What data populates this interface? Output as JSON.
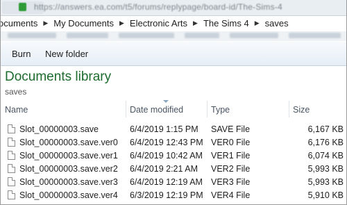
{
  "browser": {
    "url": "https://answers.ea.com/t5/forums/replypage/board-id/The-Sims-4"
  },
  "breadcrumb": [
    "ocuments",
    "My Documents",
    "Electronic Arts",
    "The Sims 4",
    "saves"
  ],
  "toolbar": {
    "burn_label": "Burn",
    "new_folder_label": "New folder"
  },
  "library": {
    "title": "Documents library",
    "subtitle": "saves"
  },
  "columns": {
    "name": "Name",
    "date": "Date modified",
    "type": "Type",
    "size": "Size"
  },
  "files": [
    {
      "name": "Slot_00000003.save",
      "date": "6/4/2019 1:15 PM",
      "type": "SAVE File",
      "size": "6,167 KB"
    },
    {
      "name": "Slot_00000003.save.ver0",
      "date": "6/4/2019 12:43 PM",
      "type": "VER0 File",
      "size": "6,176 KB"
    },
    {
      "name": "Slot_00000003.save.ver1",
      "date": "6/4/2019 10:42 AM",
      "type": "VER1 File",
      "size": "6,074 KB"
    },
    {
      "name": "Slot_00000003.save.ver2",
      "date": "6/4/2019 2:21 AM",
      "type": "VER2 File",
      "size": "5,993 KB"
    },
    {
      "name": "Slot_00000003.save.ver3",
      "date": "6/4/2019 12:19 AM",
      "type": "VER3 File",
      "size": "5,993 KB"
    },
    {
      "name": "Slot_00000003.save.ver4",
      "date": "6/3/2019 12:19 PM",
      "type": "VER4 File",
      "size": "5,910 KB"
    }
  ],
  "colors": {
    "library_title": "#1e6b2e",
    "toolbar_top": "#f7fafd",
    "toolbar_bottom": "#e6eef6"
  }
}
